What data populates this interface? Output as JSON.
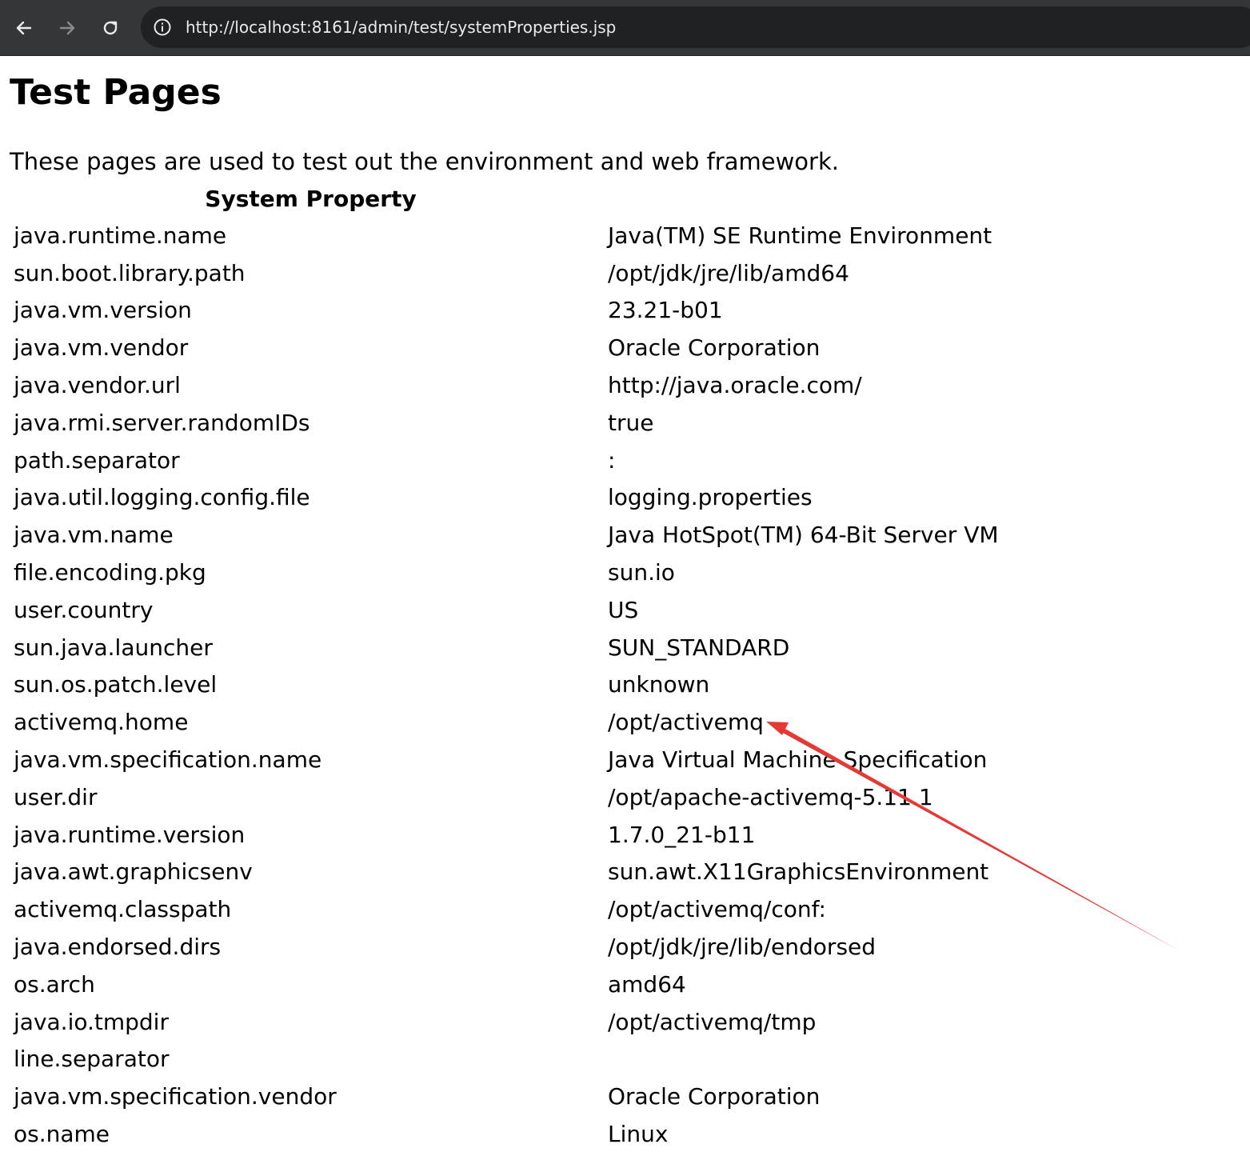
{
  "browser": {
    "url": "http://localhost:8161/admin/test/systemProperties.jsp",
    "icons": {
      "back": "arrow-left-icon",
      "forward": "arrow-right-icon",
      "reload": "reload-icon",
      "site_info": "info-circle-icon"
    }
  },
  "page": {
    "title": "Test Pages",
    "intro": "These pages are used to test out the environment and web framework.",
    "table_header": "System Property"
  },
  "properties": [
    {
      "name": "java.runtime.name",
      "value": "Java(TM) SE Runtime Environment"
    },
    {
      "name": "sun.boot.library.path",
      "value": "/opt/jdk/jre/lib/amd64"
    },
    {
      "name": "java.vm.version",
      "value": "23.21-b01"
    },
    {
      "name": "java.vm.vendor",
      "value": "Oracle Corporation"
    },
    {
      "name": "java.vendor.url",
      "value": "http://java.oracle.com/"
    },
    {
      "name": "java.rmi.server.randomIDs",
      "value": "true"
    },
    {
      "name": "path.separator",
      "value": ":"
    },
    {
      "name": "java.util.logging.config.file",
      "value": "logging.properties"
    },
    {
      "name": "java.vm.name",
      "value": "Java HotSpot(TM) 64-Bit Server VM"
    },
    {
      "name": "file.encoding.pkg",
      "value": "sun.io"
    },
    {
      "name": "user.country",
      "value": "US"
    },
    {
      "name": "sun.java.launcher",
      "value": "SUN_STANDARD"
    },
    {
      "name": "sun.os.patch.level",
      "value": "unknown"
    },
    {
      "name": "activemq.home",
      "value": "/opt/activemq"
    },
    {
      "name": "java.vm.specification.name",
      "value": "Java Virtual Machine Specification"
    },
    {
      "name": "user.dir",
      "value": "/opt/apache-activemq-5.11.1"
    },
    {
      "name": "java.runtime.version",
      "value": "1.7.0_21-b11"
    },
    {
      "name": "java.awt.graphicsenv",
      "value": "sun.awt.X11GraphicsEnvironment"
    },
    {
      "name": "activemq.classpath",
      "value": "/opt/activemq/conf:"
    },
    {
      "name": "java.endorsed.dirs",
      "value": "/opt/jdk/jre/lib/endorsed"
    },
    {
      "name": "os.arch",
      "value": "amd64"
    },
    {
      "name": "java.io.tmpdir",
      "value": "/opt/activemq/tmp"
    },
    {
      "name": "line.separator",
      "value": ""
    },
    {
      "name": "java.vm.specification.vendor",
      "value": "Oracle Corporation"
    },
    {
      "name": "os.name",
      "value": "Linux"
    }
  ],
  "annotation": {
    "type": "arrow",
    "color": "#e53935",
    "points_to": "activemq.home value"
  }
}
